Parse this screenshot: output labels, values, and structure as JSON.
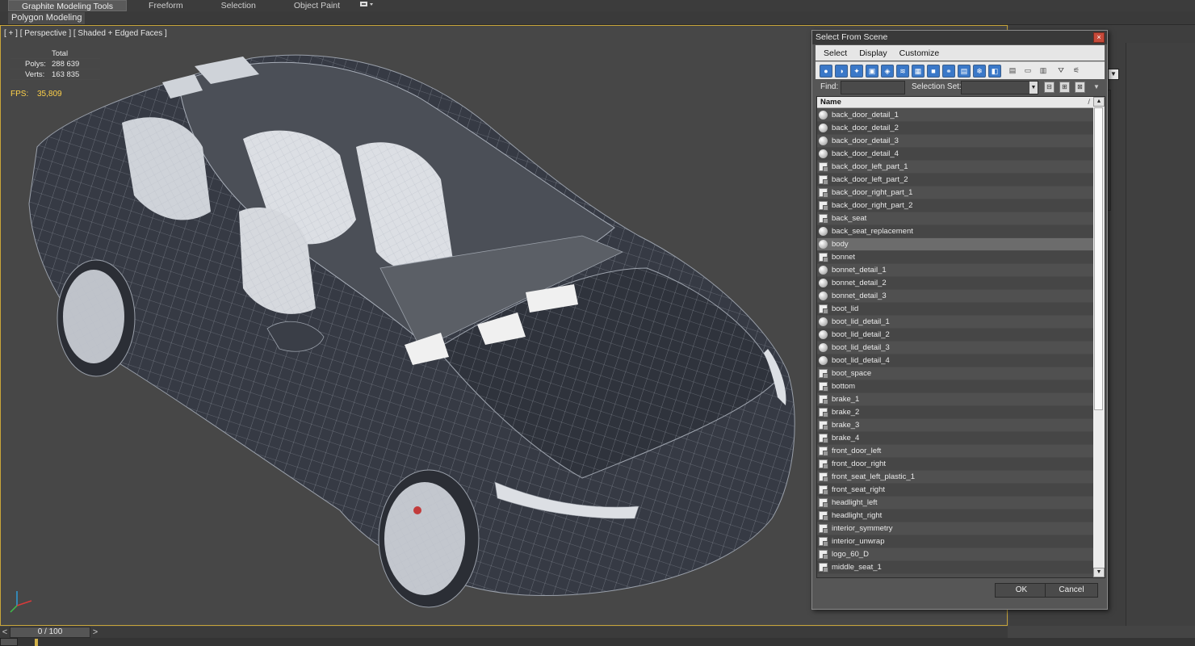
{
  "ribbon": {
    "tabs": [
      "Graphite Modeling Tools",
      "Freeform",
      "Selection",
      "Object Paint"
    ],
    "sub_tab": "Polygon Modeling"
  },
  "viewport": {
    "label": "[ + ] [ Perspective ] [ Shaded + Edged Faces ]",
    "stats_header": "Total",
    "polys_label": "Polys:",
    "polys_value": "288 639",
    "verts_label": "Verts:",
    "verts_value": "163 835",
    "fps_label": "FPS:",
    "fps_value": "35,809"
  },
  "timeline": {
    "prev": "<",
    "value": "0 / 100",
    "next": ">"
  },
  "dialog": {
    "title": "Select From Scene",
    "close": "×",
    "menu": [
      "Select",
      "Display",
      "Customize"
    ],
    "find_label": "Find:",
    "find_value": "",
    "selection_set_label": "Selection Set:",
    "column_header": "Name",
    "sort_glyph": "/",
    "ok_label": "OK",
    "cancel_label": "Cancel",
    "objects": [
      {
        "name": "back_door_detail_1",
        "icon": "sphere-icon"
      },
      {
        "name": "back_door_detail_2",
        "icon": "sphere-icon"
      },
      {
        "name": "back_door_detail_3",
        "icon": "sphere-icon"
      },
      {
        "name": "back_door_detail_4",
        "icon": "sphere-icon"
      },
      {
        "name": "back_door_left_part_1",
        "icon": "group-icon"
      },
      {
        "name": "back_door_left_part_2",
        "icon": "group-icon"
      },
      {
        "name": "back_door_right_part_1",
        "icon": "group-icon"
      },
      {
        "name": "back_door_right_part_2",
        "icon": "group-icon"
      },
      {
        "name": "back_seat",
        "icon": "group-icon"
      },
      {
        "name": "back_seat_replacement",
        "icon": "sphere-icon"
      },
      {
        "name": "body",
        "icon": "sphere-icon",
        "selected": true
      },
      {
        "name": "bonnet",
        "icon": "group-icon"
      },
      {
        "name": "bonnet_detail_1",
        "icon": "sphere-icon"
      },
      {
        "name": "bonnet_detail_2",
        "icon": "sphere-icon"
      },
      {
        "name": "bonnet_detail_3",
        "icon": "sphere-icon"
      },
      {
        "name": "boot_lid",
        "icon": "group-icon"
      },
      {
        "name": "boot_lid_detail_1",
        "icon": "sphere-icon"
      },
      {
        "name": "boot_lid_detail_2",
        "icon": "sphere-icon"
      },
      {
        "name": "boot_lid_detail_3",
        "icon": "sphere-icon"
      },
      {
        "name": "boot_lid_detail_4",
        "icon": "sphere-icon"
      },
      {
        "name": "boot_space",
        "icon": "group-icon"
      },
      {
        "name": "bottom",
        "icon": "group-icon"
      },
      {
        "name": "brake_1",
        "icon": "group-icon"
      },
      {
        "name": "brake_2",
        "icon": "group-icon"
      },
      {
        "name": "brake_3",
        "icon": "group-icon"
      },
      {
        "name": "brake_4",
        "icon": "group-icon"
      },
      {
        "name": "front_door_left",
        "icon": "group-icon"
      },
      {
        "name": "front_door_right",
        "icon": "group-icon"
      },
      {
        "name": "front_seat_left_plastic_1",
        "icon": "group-icon"
      },
      {
        "name": "front_seat_right",
        "icon": "group-icon"
      },
      {
        "name": "headlight_left",
        "icon": "group-icon"
      },
      {
        "name": "headlight_right",
        "icon": "group-icon"
      },
      {
        "name": "interior_symmetry",
        "icon": "group-icon"
      },
      {
        "name": "interior_unwrap",
        "icon": "group-icon"
      },
      {
        "name": "logo_60_D",
        "icon": "group-icon"
      },
      {
        "name": "middle_seat_1",
        "icon": "group-icon"
      }
    ]
  }
}
